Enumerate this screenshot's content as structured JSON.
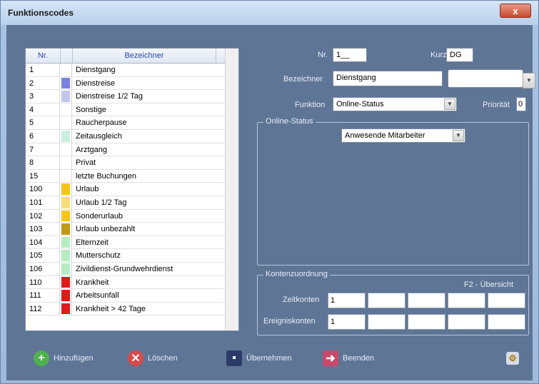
{
  "window": {
    "title": "Funktionscodes",
    "close_label": "x"
  },
  "list": {
    "header": {
      "nr": "Nr.",
      "name": "Bezeichner"
    },
    "rows": [
      {
        "nr": "1",
        "name": "Dienstgang",
        "color": "#ffffff"
      },
      {
        "nr": "2",
        "name": "Dienstreise",
        "color": "#7b83e0"
      },
      {
        "nr": "3",
        "name": "Dienstreise 1/2 Tag",
        "color": "#c3c6f2"
      },
      {
        "nr": "4",
        "name": "Sonstige",
        "color": "#ffffff"
      },
      {
        "nr": "5",
        "name": "Raucherpause",
        "color": "#ffffff"
      },
      {
        "nr": "6",
        "name": "Zeitausgleich",
        "color": "#c8f0e0"
      },
      {
        "nr": "7",
        "name": "Arztgang",
        "color": "#ffffff"
      },
      {
        "nr": "8",
        "name": "Privat",
        "color": "#ffffff"
      },
      {
        "nr": "15",
        "name": "letzte Buchungen",
        "color": "#ffffff"
      },
      {
        "nr": "100",
        "name": "Urlaub",
        "color": "#f4c518"
      },
      {
        "nr": "101",
        "name": "Urlaub 1/2 Tag",
        "color": "#f7dc7a"
      },
      {
        "nr": "102",
        "name": "Sonderurlaub",
        "color": "#f4c518"
      },
      {
        "nr": "103",
        "name": "Urlaub unbezahlt",
        "color": "#c09a14"
      },
      {
        "nr": "104",
        "name": "Elternzeit",
        "color": "#b6ecc2"
      },
      {
        "nr": "105",
        "name": "Mutterschutz",
        "color": "#b6ecc2"
      },
      {
        "nr": "106",
        "name": "Zivildienst-Grundwehrdienst",
        "color": "#b6ecc2"
      },
      {
        "nr": "110",
        "name": "Krankheit",
        "color": "#e01a1a"
      },
      {
        "nr": "111",
        "name": "Arbeitsunfall",
        "color": "#e01a1a"
      },
      {
        "nr": "112",
        "name": "Krankheit > 42 Tage",
        "color": "#e01a1a"
      }
    ]
  },
  "form": {
    "nr_label": "Nr.",
    "nr_value": "1__",
    "kurz_label": "Kurz",
    "kurz_value": "DG",
    "bezeichner_label": "Bezeichner",
    "bezeichner_value": "Dienstgang",
    "funktion_label": "Funktion",
    "funktion_value": "Online-Status",
    "prioritaet_label": "Priorität",
    "prioritaet_value": "0"
  },
  "online_status": {
    "title": "Online-Status",
    "select_value": "Anwesende Mitarbeiter"
  },
  "konten": {
    "title": "Kontenzuordnung",
    "overview_hint": "F2 - Übersicht",
    "zeitkonten_label": "Zeitkonten",
    "zeitkonten_values": [
      "1",
      "",
      "",
      "",
      ""
    ],
    "ereigniskonten_label": "Ereigniskonten",
    "ereigniskonten_values": [
      "1",
      "",
      "",
      "",
      ""
    ]
  },
  "buttons": {
    "add": "Hinzufügen",
    "delete": "Löschen",
    "apply": "Übernehmen",
    "exit": "Beenden"
  }
}
